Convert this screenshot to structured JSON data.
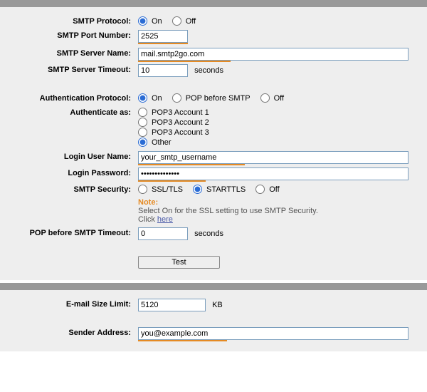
{
  "labels": {
    "smtp_protocol": "SMTP Protocol:",
    "smtp_port": "SMTP Port Number:",
    "smtp_server": "SMTP Server Name:",
    "smtp_timeout": "SMTP Server Timeout:",
    "auth_protocol": "Authentication Protocol:",
    "auth_as": "Authenticate as:",
    "login_user": "Login User Name:",
    "login_pass": "Login Password:",
    "smtp_security": "SMTP Security:",
    "pop_timeout": "POP before SMTP Timeout:",
    "email_size": "E-mail Size Limit:",
    "sender_addr": "Sender Address:"
  },
  "options": {
    "on": "On",
    "off": "Off",
    "pop_before_smtp": "POP before SMTP",
    "pop3_1": "POP3 Account 1",
    "pop3_2": "POP3 Account 2",
    "pop3_3": "POP3 Account 3",
    "other": "Other",
    "ssl": "SSL/TLS",
    "starttls": "STARTTLS"
  },
  "values": {
    "port": "2525",
    "server": "mail.smtp2go.com",
    "timeout": "10",
    "login_user": "your_smtp_username",
    "login_pass": "••••••••••••••",
    "pop_timeout": "0",
    "email_size": "5120",
    "sender": "you@example.com"
  },
  "units": {
    "seconds": "seconds",
    "kb": "KB"
  },
  "note": {
    "label": "Note:",
    "text": "Select On for the SSL setting to use SMTP Security.",
    "click": "Click ",
    "here": "here"
  },
  "buttons": {
    "test": "Test"
  },
  "colors": {
    "accent": "#e58a23"
  }
}
